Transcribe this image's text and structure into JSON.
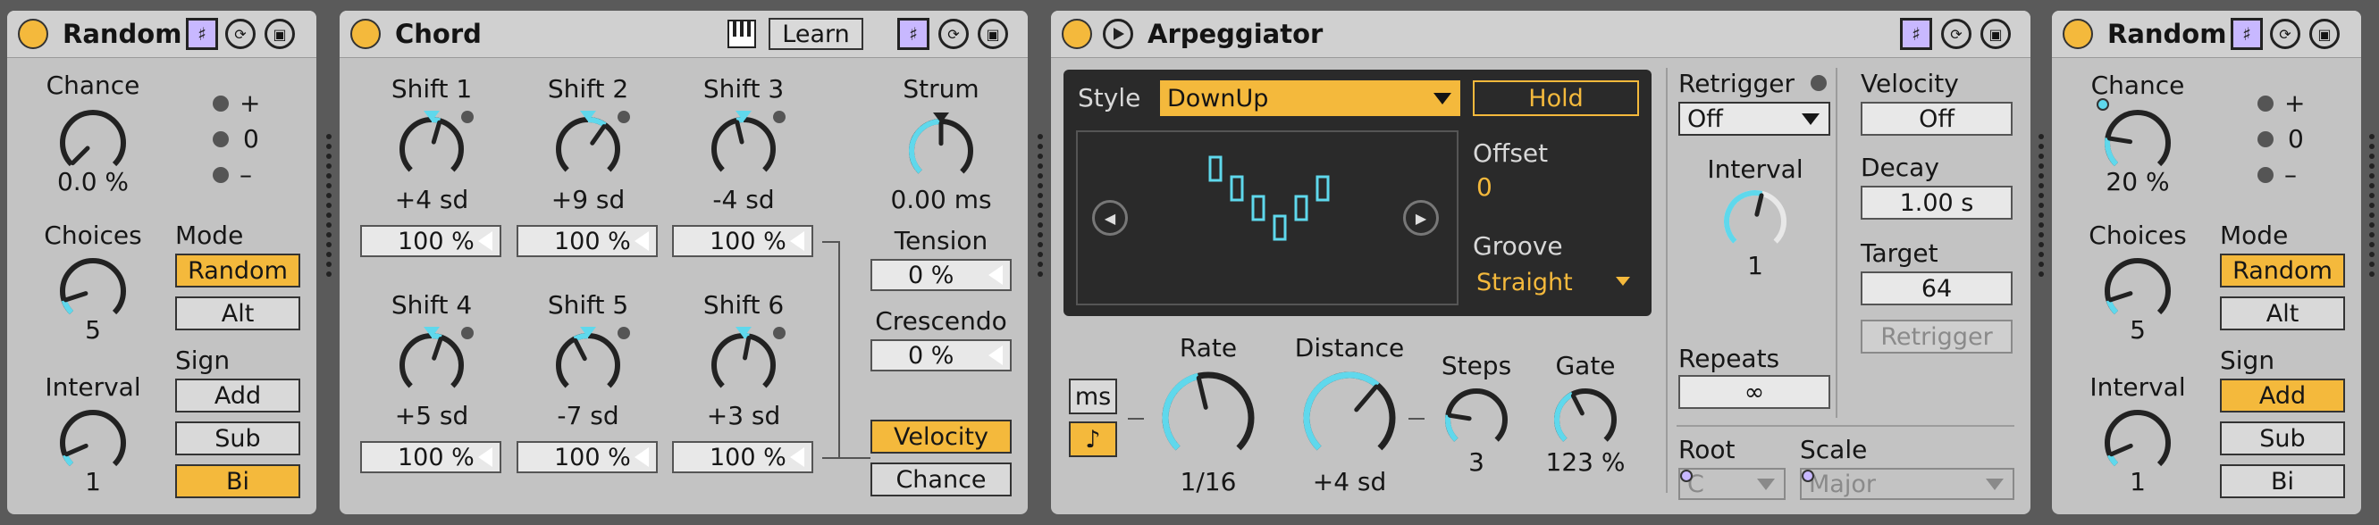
{
  "random1": {
    "title": "Random",
    "chance": {
      "label": "Chance",
      "value": "0.0 %",
      "level": 0.0
    },
    "choices": {
      "label": "Choices",
      "value": "5",
      "level": 0.1
    },
    "interval": {
      "label": "Interval",
      "value": "1",
      "level": 0.08
    },
    "sign_legend": [
      "+",
      "0",
      "–"
    ],
    "mode": {
      "label": "Mode",
      "options": [
        "Random",
        "Alt"
      ],
      "active": "Random"
    },
    "sign": {
      "label": "Sign",
      "options": [
        "Add",
        "Sub",
        "Bi"
      ],
      "active": "Bi"
    }
  },
  "chord": {
    "title": "Chord",
    "learn_label": "Learn",
    "shifts": [
      {
        "label": "Shift 1",
        "value": "+4 sd",
        "velocity": "100 %",
        "level": 0.56
      },
      {
        "label": "Shift 2",
        "value": "+9 sd",
        "velocity": "100 %",
        "level": 0.63
      },
      {
        "label": "Shift 3",
        "value": "-4 sd",
        "velocity": "100 %",
        "level": 0.45
      },
      {
        "label": "Shift 4",
        "value": "+5 sd",
        "velocity": "100 %",
        "level": 0.57
      },
      {
        "label": "Shift 5",
        "value": "-7 sd",
        "velocity": "100 %",
        "level": 0.4
      },
      {
        "label": "Shift 6",
        "value": "+3 sd",
        "velocity": "100 %",
        "level": 0.54
      }
    ],
    "strum": {
      "label": "Strum",
      "value": "0.00 ms",
      "level": 0.5
    },
    "tension": {
      "label": "Tension",
      "value": "0 %"
    },
    "crescendo": {
      "label": "Crescendo",
      "value": "0 %"
    },
    "velocity_label": "Velocity",
    "chance_label": "Chance",
    "mode_active": "Velocity"
  },
  "arpeggiator": {
    "title": "Arpeggiator",
    "style": {
      "label": "Style",
      "value": "DownUp"
    },
    "hold_label": "Hold",
    "offset": {
      "label": "Offset",
      "value": "0"
    },
    "groove": {
      "label": "Groove",
      "value": "Straight"
    },
    "pattern_steps": [
      7,
      5,
      3,
      1,
      3,
      5
    ],
    "rate_modes": [
      "ms",
      "♪"
    ],
    "rate": {
      "label": "Rate",
      "value": "1/16",
      "level": 0.45
    },
    "distance": {
      "label": "Distance",
      "value": "+4 sd",
      "level": 0.65
    },
    "steps": {
      "label": "Steps",
      "value": "3",
      "level": 0.2
    },
    "gate": {
      "label": "Gate",
      "value": "123 %",
      "level": 0.4
    },
    "retrigger": {
      "label": "Retrigger",
      "value": "Off"
    },
    "interval": {
      "label": "Interval",
      "value": "1",
      "level": 0.55
    },
    "repeats": {
      "label": "Repeats",
      "value": "∞"
    },
    "velocity": {
      "label": "Velocity",
      "value": "Off"
    },
    "decay": {
      "label": "Decay",
      "value": "1.00 s"
    },
    "target": {
      "label": "Target",
      "value": "64"
    },
    "retrigger_button": "Retrigger",
    "root": {
      "label": "Root",
      "value": "C"
    },
    "scale": {
      "label": "Scale",
      "value": "Major"
    }
  },
  "random2": {
    "title": "Random",
    "chance": {
      "label": "Chance",
      "value": "20 %",
      "level": 0.2
    },
    "choices": {
      "label": "Choices",
      "value": "5",
      "level": 0.1
    },
    "interval": {
      "label": "Interval",
      "value": "1",
      "level": 0.08
    },
    "sign_legend": [
      "+",
      "0",
      "–"
    ],
    "mode": {
      "label": "Mode",
      "options": [
        "Random",
        "Alt"
      ],
      "active": "Random"
    },
    "sign": {
      "label": "Sign",
      "options": [
        "Add",
        "Sub",
        "Bi"
      ],
      "active": "Add"
    }
  },
  "colors": {
    "accent": "#f4b93c",
    "knob_arc": "#5fd8ec",
    "panel": "#c3c3c3",
    "arp_bg": "#2a2a2a"
  }
}
